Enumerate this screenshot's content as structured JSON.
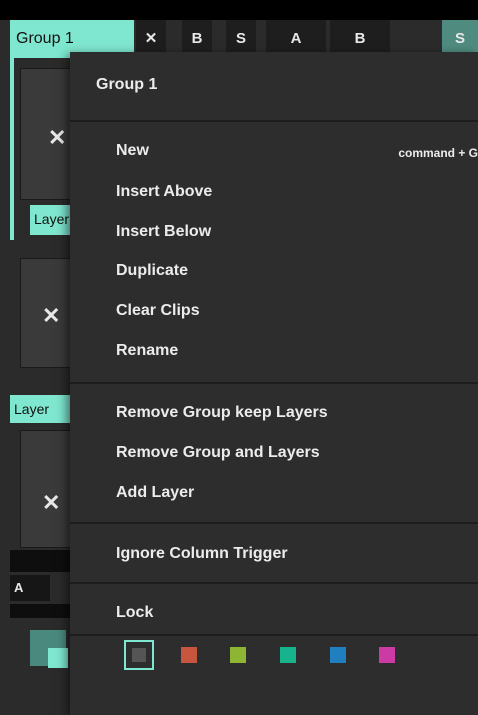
{
  "background": {
    "group_tab_label": "Group 1",
    "header_buttons": [
      "✕",
      "B",
      "S",
      "A",
      "B",
      "S"
    ],
    "layer_label_1": "Layer",
    "layer_label_2": "Layer",
    "column_button": "A",
    "colors": {
      "accent": "#7fe7cf",
      "panel": "#2d2d2d"
    }
  },
  "menu": {
    "title": "Group 1",
    "items_group1": [
      {
        "label": "New",
        "shortcut": "command + G"
      },
      {
        "label": "Insert Above"
      },
      {
        "label": "Insert Below"
      },
      {
        "label": "Duplicate"
      },
      {
        "label": "Clear Clips"
      },
      {
        "label": "Rename"
      }
    ],
    "items_group2": [
      {
        "label": "Remove Group keep Layers"
      },
      {
        "label": "Remove Group and Layers"
      },
      {
        "label": "Add Layer"
      }
    ],
    "items_group3": [
      {
        "label": "Ignore Column Trigger"
      }
    ],
    "items_group4": [
      {
        "label": "Lock"
      }
    ],
    "color_swatches": [
      "#555555",
      "#c8553d",
      "#8fb534",
      "#17b38c",
      "#1f7fbf",
      "#cc3aa6"
    ],
    "selected_swatch": 0
  }
}
